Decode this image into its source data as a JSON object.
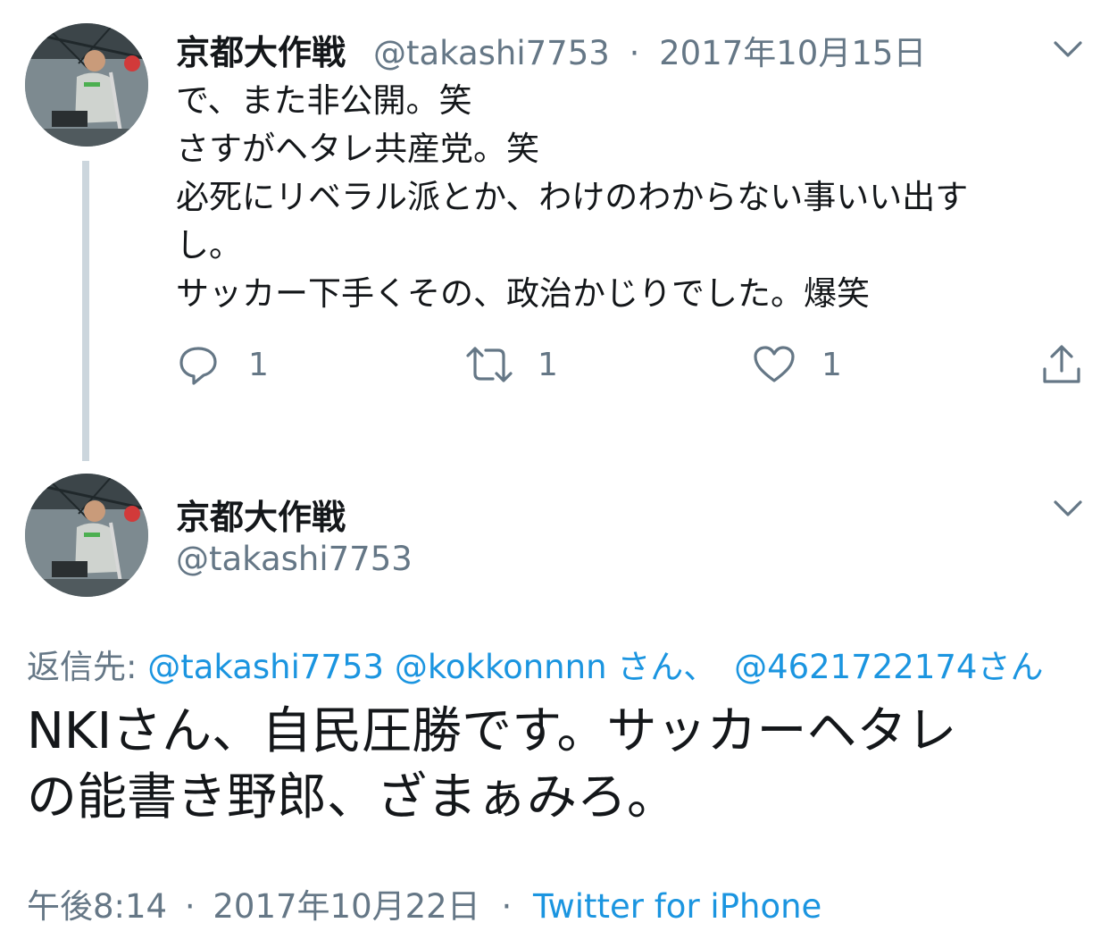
{
  "tweet1": {
    "name": "京都大作戦",
    "handle": "@takashi7753",
    "separator": "·",
    "date": "2017年10月15日",
    "lines": [
      "で、また非公開。笑",
      "さすがヘタレ共産党。笑",
      "必死にリベラル派とか、わけのわからない事いい出す",
      "し。",
      "サッカー下手くその、政治かじりでした。爆笑"
    ],
    "actions": {
      "reply_count": "1",
      "retweet_count": "1",
      "like_count": "1"
    },
    "icons": [
      "reply-icon",
      "retweet-icon",
      "like-icon",
      "share-icon",
      "chevron-down-icon"
    ]
  },
  "tweet2": {
    "name": "京都大作戦",
    "handle": "@takashi7753",
    "reply_to": {
      "prefix": "返信先: ",
      "mention1": "@takashi7753",
      "mention2": "@kokkonnnn",
      "san1": " さん、",
      "mention3": "@4621722174",
      "san2": "さん"
    },
    "lines": [
      "NKIさん、自民圧勝です。サッカーヘタレ",
      "の能書き野郎、ざまぁみろ。"
    ],
    "time": "午後8:14",
    "separator": "·",
    "date": "2017年10月22日",
    "source": "Twitter for iPhone"
  },
  "colors": {
    "text": "#14171a",
    "secondary": "#657786",
    "link": "#1b95e0",
    "thread_line": "#ccd6dd"
  }
}
